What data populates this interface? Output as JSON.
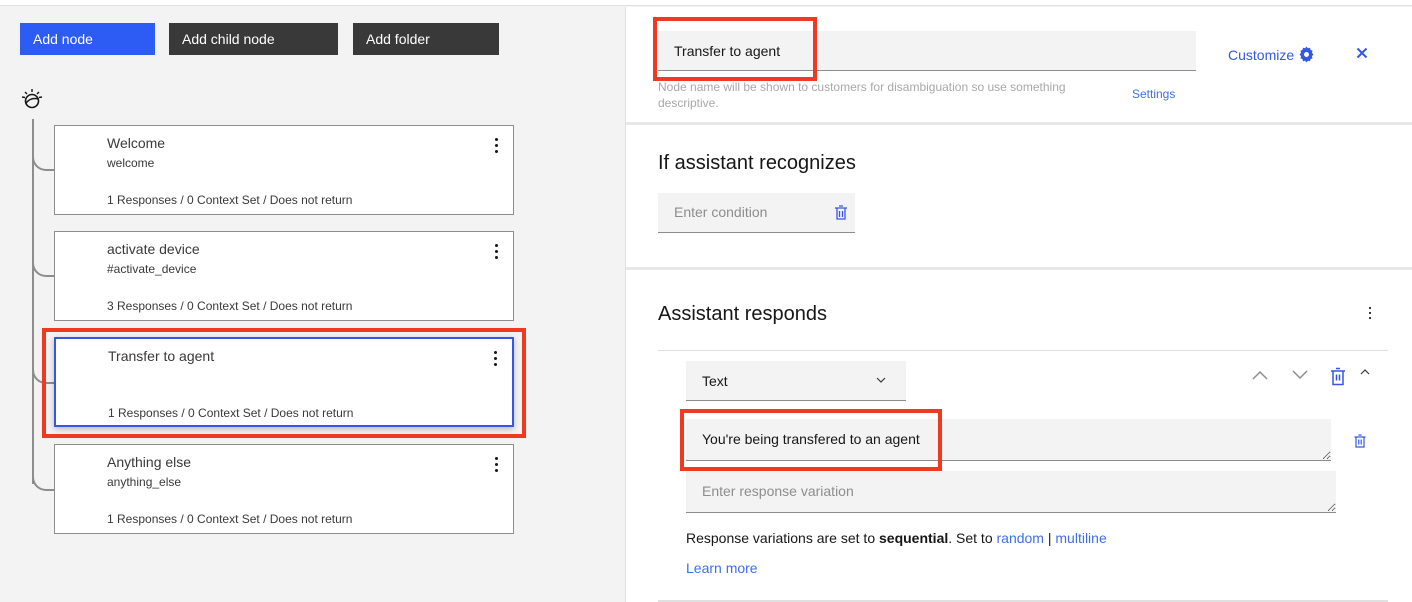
{
  "toolbar": {
    "add_node": "Add node",
    "add_child_node": "Add child node",
    "add_folder": "Add folder"
  },
  "nodes": [
    {
      "title": "Welcome",
      "condition": "welcome",
      "meta": "1 Responses / 0 Context Set / Does not return",
      "selected": false
    },
    {
      "title": "activate device",
      "condition": "#activate_device",
      "meta": "3 Responses / 0 Context Set / Does not return",
      "selected": false
    },
    {
      "title": "Transfer to agent",
      "condition": "",
      "meta": "1 Responses / 0 Context Set / Does not return",
      "selected": true
    },
    {
      "title": "Anything else",
      "condition": "anything_else",
      "meta": "1 Responses / 0 Context Set / Does not return",
      "selected": false
    }
  ],
  "editor": {
    "node_name_value": "Transfer to agent",
    "node_name_helper": "Node name will be shown to customers for disambiguation so use something descriptive.",
    "settings_link": "Settings",
    "customize_label": "Customize",
    "recognizes_heading": "If assistant recognizes",
    "condition_placeholder": "Enter condition",
    "responds_heading": "Assistant responds",
    "response_type": "Text",
    "response_value": "You're being transfered to an agent",
    "variation_placeholder": "Enter response variation",
    "variation_prefix": "Response variations are set to ",
    "variation_mode": "sequential",
    "variation_mid": ". Set to ",
    "variation_random": "random",
    "variation_sep": " | ",
    "variation_multiline": "multiline",
    "learn_more": "Learn more"
  },
  "colors": {
    "primary": "#2d5cf5",
    "link": "#3d70e8",
    "highlight": "#f03a1f",
    "selected_border": "#3457e8"
  }
}
